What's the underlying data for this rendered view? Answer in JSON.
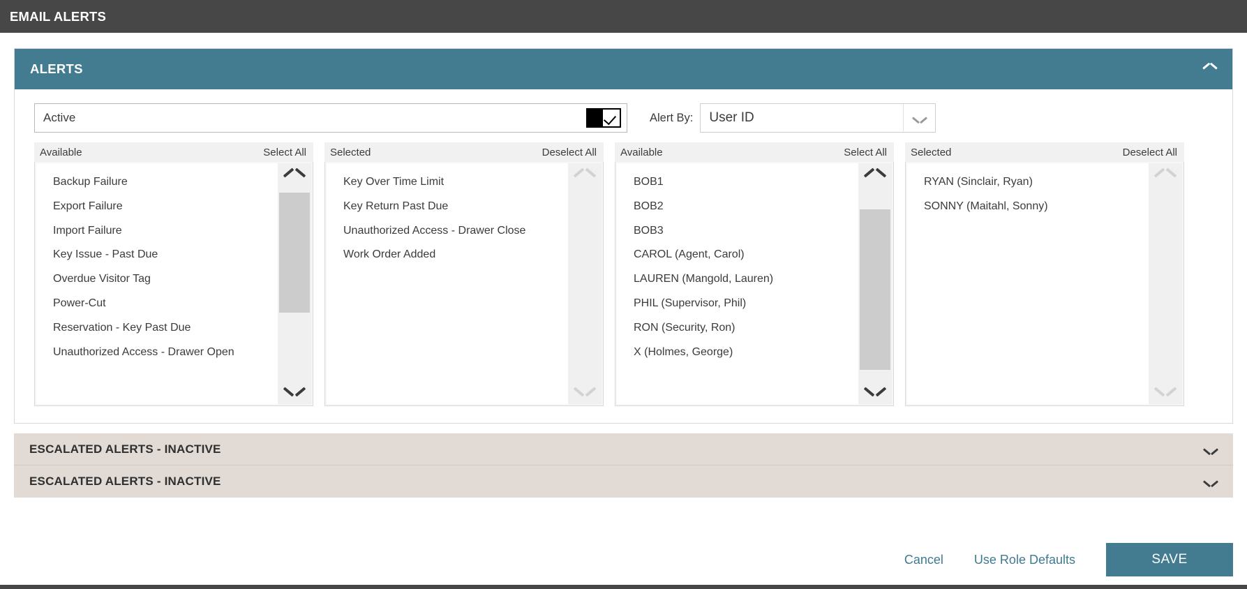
{
  "titlebar": {
    "title": "EMAIL ALERTS"
  },
  "card": {
    "title": "ALERTS",
    "collapse_icon": "chevron-up-icon",
    "accent_color": "#437c91"
  },
  "filter": {
    "active_label": "Active",
    "active_checked": true,
    "checkbox_icon": "checkmark-icon",
    "alert_by_label": "Alert By:",
    "alert_by_value": "User ID",
    "alert_by_icon": "chevron-down-icon"
  },
  "panels": [
    {
      "header": "Available",
      "action": "Select All",
      "scroll_up_icon": "chevron-up-icon",
      "scroll_down_icon": "chevron-down-icon",
      "scroll_enabled": true,
      "items": [
        "Backup Failure",
        "Export Failure",
        "Import Failure",
        "Key Issue - Past Due",
        "Overdue Visitor Tag",
        "Power-Cut",
        "Reservation - Key Past Due",
        "Unauthorized Access - Drawer Open"
      ]
    },
    {
      "header": "Selected",
      "action": "Deselect All",
      "scroll_up_icon": "chevron-up-icon",
      "scroll_down_icon": "chevron-down-icon",
      "scroll_enabled": false,
      "items": [
        "Key Over Time Limit",
        "Key Return Past Due",
        "Unauthorized Access - Drawer Close",
        "Work Order Added"
      ]
    },
    {
      "header": "Available",
      "action": "Select All",
      "scroll_up_icon": "chevron-up-icon",
      "scroll_down_icon": "chevron-down-icon",
      "scroll_enabled": true,
      "items": [
        "BOB1",
        "BOB2",
        "BOB3",
        "CAROL (Agent, Carol)",
        "LAUREN (Mangold, Lauren)",
        "PHIL (Supervisor, Phil)",
        "RON (Security, Ron)",
        "X (Holmes, George)"
      ]
    },
    {
      "header": "Selected",
      "action": "Deselect All",
      "scroll_up_icon": "chevron-up-icon",
      "scroll_down_icon": "chevron-down-icon",
      "scroll_enabled": false,
      "items": [
        "RYAN (Sinclair, Ryan)",
        "SONNY (Maitahl, Sonny)"
      ]
    }
  ],
  "accordions": [
    {
      "title": "ESCALATED ALERTS - INACTIVE",
      "icon": "chevron-down-icon"
    },
    {
      "title": "ESCALATED ALERTS - INACTIVE",
      "icon": "chevron-down-icon"
    }
  ],
  "footer": {
    "cancel_label": "Cancel",
    "defaults_label": "Use Role Defaults",
    "save_label": "SAVE"
  }
}
